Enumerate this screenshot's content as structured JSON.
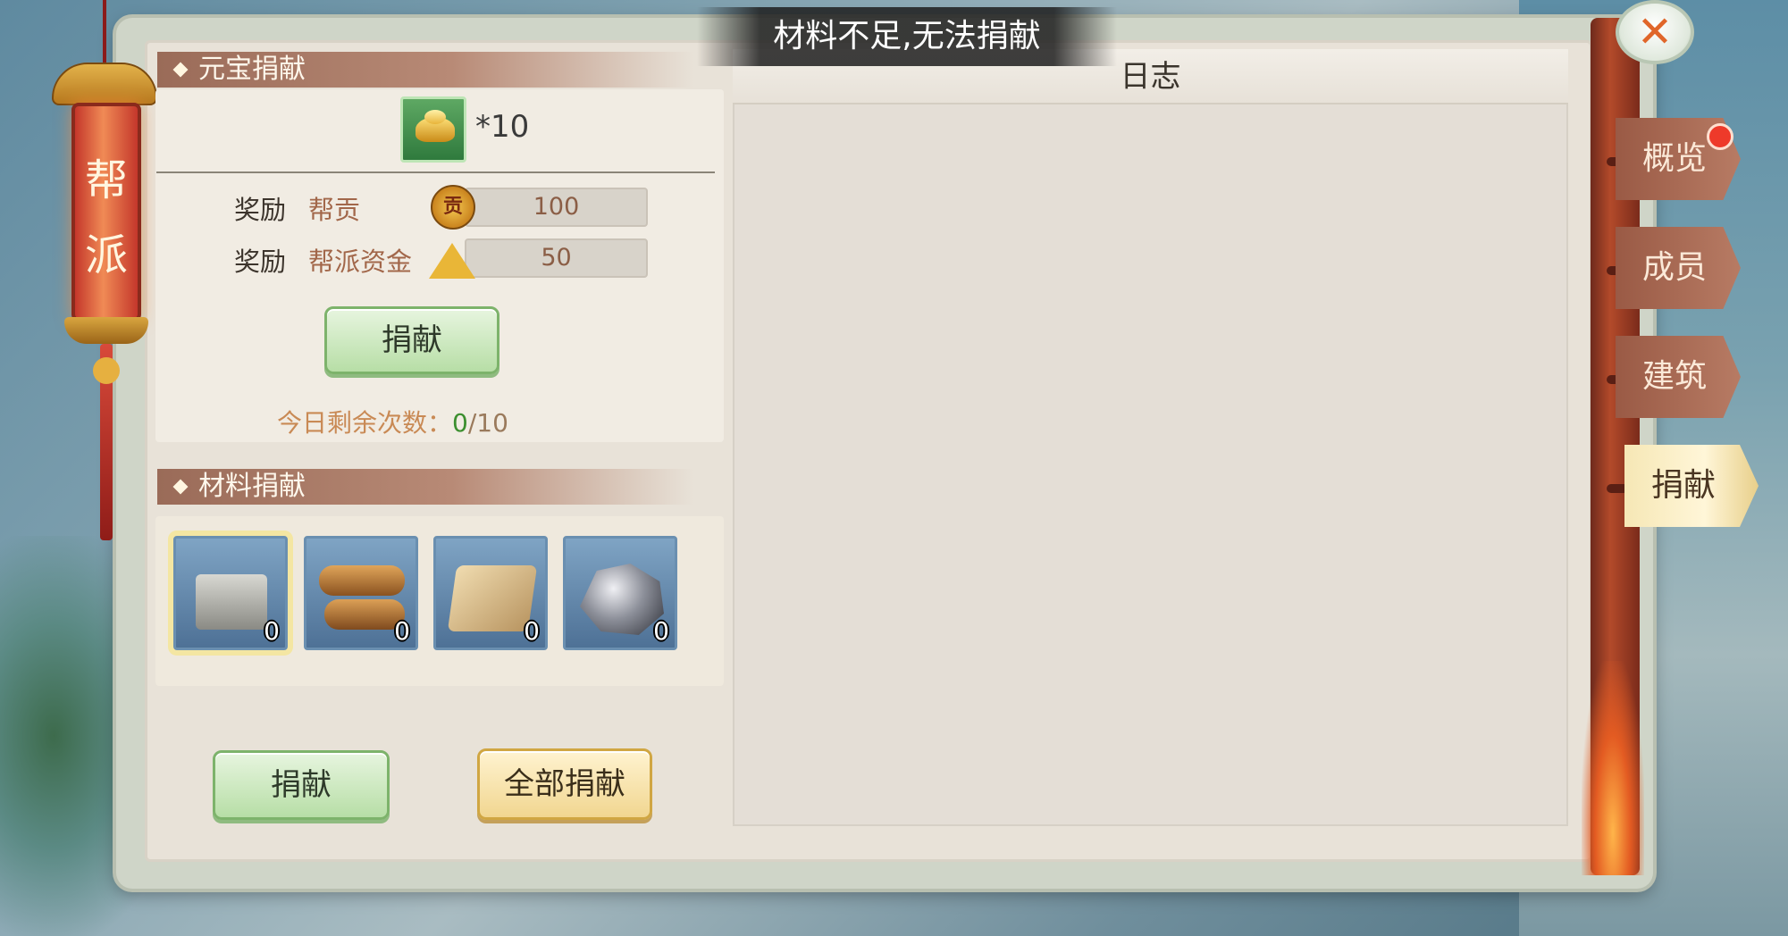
{
  "toast": "材料不足,无法捐献",
  "lantern": "帮派",
  "close_glyph": "✕",
  "ingot_donation": {
    "header": "元宝捐献",
    "cost_count": "*10",
    "rewards": [
      {
        "label": "奖励",
        "name": "帮贡",
        "icon": "guild-contribution-coin-icon",
        "icon_glyph": "贡",
        "value": "100"
      },
      {
        "label": "奖励",
        "name": "帮派资金",
        "icon": "guild-funds-gold-icon",
        "value": "50"
      }
    ],
    "donate_button": "捐献",
    "remaining_label": "今日剩余次数：",
    "remaining_used": "0",
    "remaining_total": "/10"
  },
  "material_donation": {
    "header": "材料捐献",
    "materials": [
      {
        "icon": "stone-icon",
        "count": "0"
      },
      {
        "icon": "wood-log-icon",
        "count": "0"
      },
      {
        "icon": "cloth-icon",
        "count": "0"
      },
      {
        "icon": "ore-icon",
        "count": "0"
      }
    ],
    "donate_button": "捐献",
    "donate_all_button": "全部捐献"
  },
  "log": {
    "title": "日志"
  },
  "tabs": [
    {
      "label": "概览",
      "active": false,
      "badge": true
    },
    {
      "label": "成员",
      "active": false
    },
    {
      "label": "建筑",
      "active": false
    },
    {
      "label": "捐献",
      "active": true
    }
  ]
}
